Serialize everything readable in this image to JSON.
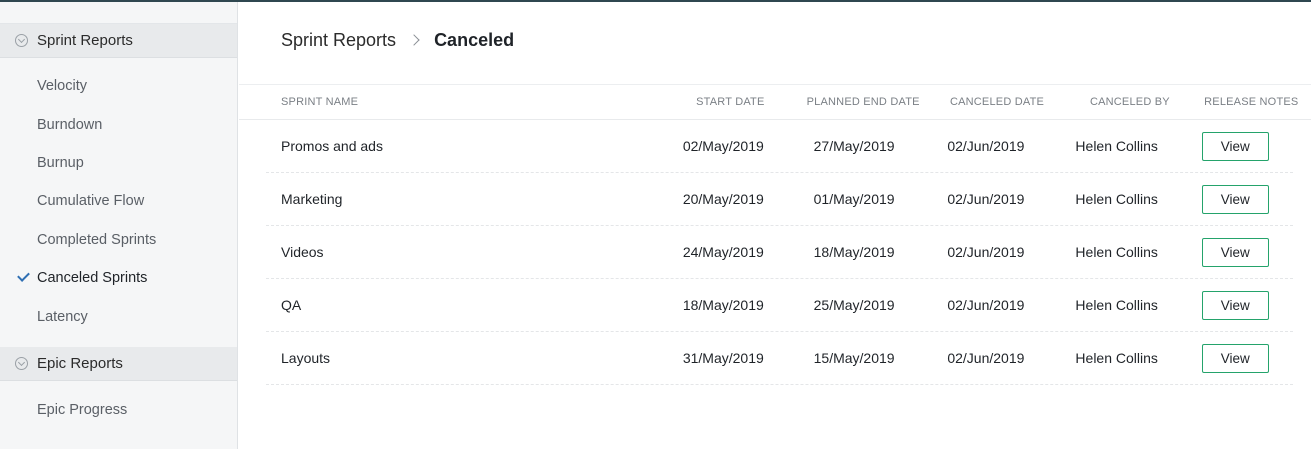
{
  "sidebar": {
    "groups": [
      {
        "label": "Sprint Reports",
        "items": [
          {
            "label": "Velocity",
            "active": false
          },
          {
            "label": "Burndown",
            "active": false
          },
          {
            "label": "Burnup",
            "active": false
          },
          {
            "label": "Cumulative Flow",
            "active": false
          },
          {
            "label": "Completed Sprints",
            "active": false
          },
          {
            "label": "Canceled Sprints",
            "active": true
          },
          {
            "label": "Latency",
            "active": false
          }
        ]
      },
      {
        "label": "Epic Reports",
        "items": [
          {
            "label": "Epic Progress",
            "active": false
          }
        ]
      }
    ]
  },
  "breadcrumb": {
    "parent": "Sprint Reports",
    "current": "Canceled"
  },
  "table": {
    "headers": {
      "name": "SPRINT NAME",
      "start": "START DATE",
      "end": "PLANNED END DATE",
      "canceled": "CANCELED DATE",
      "by": "CANCELED BY",
      "notes": "RELEASE NOTES"
    },
    "rows": [
      {
        "name": "Promos and ads",
        "start": "02/May/2019",
        "end": "27/May/2019",
        "canceled": "02/Jun/2019",
        "by": "Helen Collins",
        "action": "View"
      },
      {
        "name": "Marketing",
        "start": "20/May/2019",
        "end": "01/May/2019",
        "canceled": "02/Jun/2019",
        "by": "Helen Collins",
        "action": "View"
      },
      {
        "name": "Videos",
        "start": "24/May/2019",
        "end": "18/May/2019",
        "canceled": "02/Jun/2019",
        "by": "Helen Collins",
        "action": "View"
      },
      {
        "name": "QA",
        "start": "18/May/2019",
        "end": "25/May/2019",
        "canceled": "02/Jun/2019",
        "by": "Helen Collins",
        "action": "View"
      },
      {
        "name": "Layouts",
        "start": "31/May/2019",
        "end": "15/May/2019",
        "canceled": "02/Jun/2019",
        "by": "Helen Collins",
        "action": "View"
      }
    ]
  },
  "colors": {
    "accent": "#24a36b",
    "check": "#2f6fb3",
    "topbar": "#2f4750"
  }
}
